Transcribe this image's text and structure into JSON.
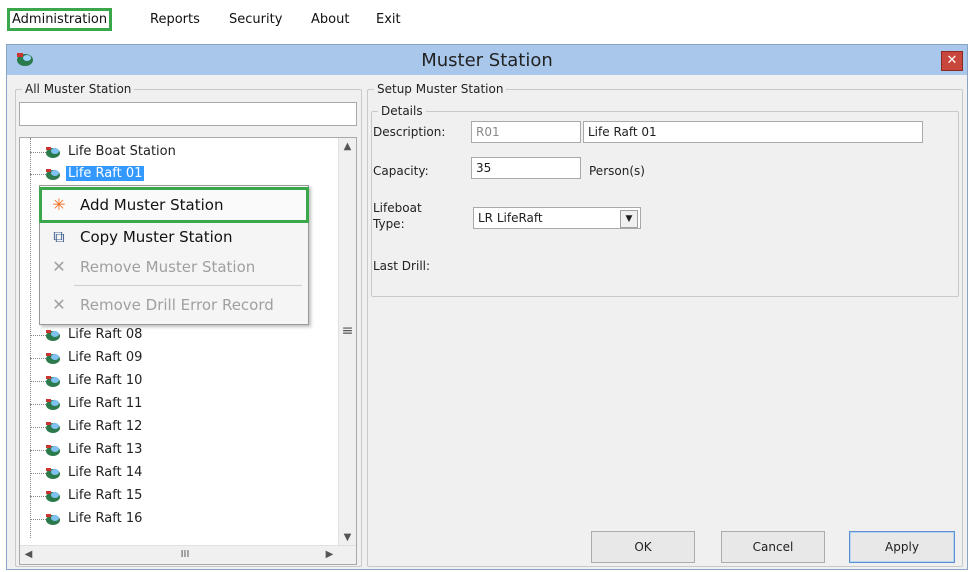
{
  "menubar": {
    "items": [
      "Administration",
      "Reports",
      "Security",
      "About",
      "Exit"
    ]
  },
  "window": {
    "title": "Muster Station"
  },
  "left_panel": {
    "group_title": "All Muster Station",
    "filter_value": "",
    "tree_items": [
      {
        "label": "Life Boat Station",
        "selected": false
      },
      {
        "label": "Life Raft 01",
        "selected": true
      },
      {
        "label": "Life Raft 08",
        "selected": false
      },
      {
        "label": "Life Raft 09",
        "selected": false
      },
      {
        "label": "Life Raft 10",
        "selected": false
      },
      {
        "label": "Life Raft 11",
        "selected": false
      },
      {
        "label": "Life Raft 12",
        "selected": false
      },
      {
        "label": "Life Raft 13",
        "selected": false
      },
      {
        "label": "Life Raft 14",
        "selected": false
      },
      {
        "label": "Life Raft 15",
        "selected": false
      },
      {
        "label": "Life Raft 16",
        "selected": false
      }
    ],
    "scroll_mid_glyph": "≡",
    "hscroll_mid_glyph": "III"
  },
  "context_menu": {
    "items": [
      {
        "label": "Add Muster Station",
        "icon": "asterisk-icon",
        "enabled": true
      },
      {
        "label": "Copy Muster Station",
        "icon": "copy-icon",
        "enabled": true
      },
      {
        "label": "Remove Muster Station",
        "icon": "x-icon",
        "enabled": false
      },
      {
        "label": "Remove Drill Error Record",
        "icon": "x-icon",
        "enabled": false
      }
    ]
  },
  "setup": {
    "group_title": "Setup Muster Station",
    "details_title": "Details",
    "description_label": "Description:",
    "description_code": "R01",
    "description_name": "Life Raft 01",
    "capacity_label": "Capacity:",
    "capacity_value": "35",
    "capacity_unit": "Person(s)",
    "lifeboat_type_label_1": "Lifeboat",
    "lifeboat_type_label_2": "Type:",
    "lifeboat_type_value": "LR LifeRaft",
    "last_drill_label": "Last Drill:"
  },
  "buttons": {
    "ok": "OK",
    "cancel": "Cancel",
    "apply": "Apply"
  },
  "colors": {
    "titlebar": "#a8c7ea",
    "selection": "#3399ff",
    "highlight_outline": "#3aa84a",
    "close": "#c9463c"
  }
}
